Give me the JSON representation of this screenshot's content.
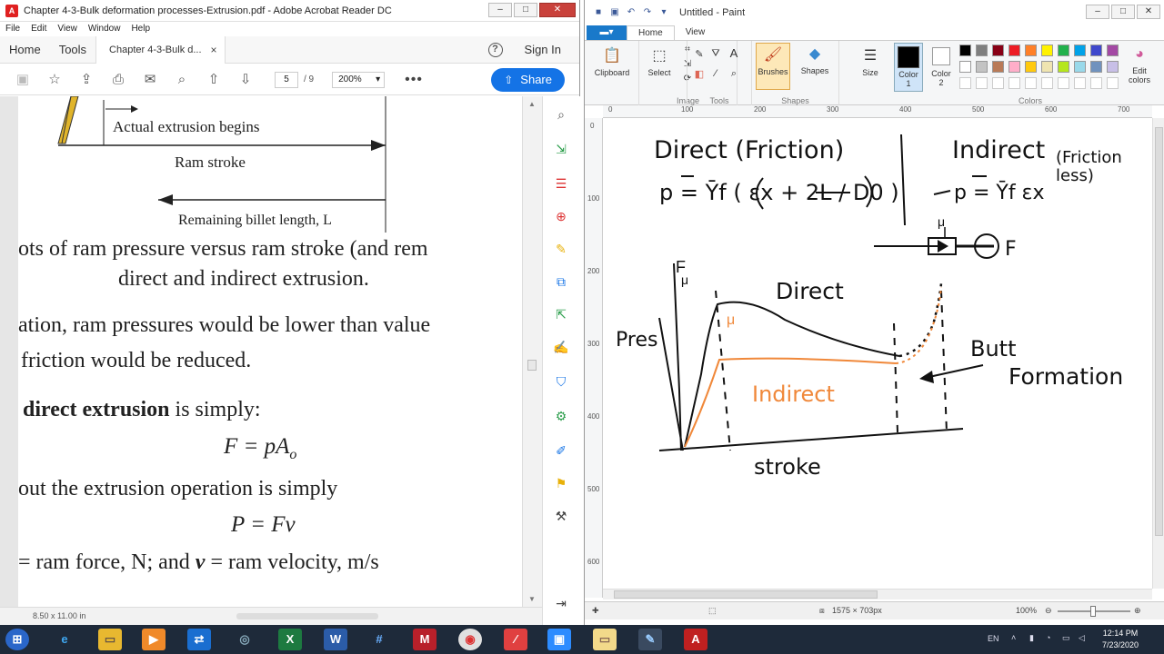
{
  "acrobat": {
    "title": "Chapter 4-3-Bulk deformation processes-Extrusion.pdf - Adobe Acrobat Reader DC",
    "menu": [
      "File",
      "Edit",
      "View",
      "Window",
      "Help"
    ],
    "tabs": {
      "home": "Home",
      "tools": "Tools",
      "doc": "Chapter 4-3-Bulk d...",
      "close": "×"
    },
    "signin": "Sign In",
    "help": "?",
    "toolbar": {
      "page_current": "5",
      "page_total": "/ 9",
      "zoom": "200%",
      "share": "Share"
    },
    "document": {
      "fig_label_begins": "Actual extrusion begins",
      "fig_label_stroke": "Ram stroke",
      "fig_label_remaining": "Remaining billet length, L",
      "line1": "ots of ram pressure versus ram stroke (and rem",
      "line2": "direct and indirect extrusion.",
      "line3": "ation, ram pressures would be lower than value",
      "line4": "friction would be reduced.",
      "line5_bold": "direct extrusion",
      "line5_rest": " is simply:",
      "eq1": "F = pA",
      "eq1_sub": "o",
      "line6": "out the extrusion operation is simply",
      "eq2": "P = Fv",
      "line7_a": "= ram force, N; and ",
      "line7_v": "v",
      "line7_b": " = ram velocity, m/s"
    },
    "status": {
      "size": "8.50 x 11.00 in"
    }
  },
  "paint": {
    "title": "Untitled - Paint",
    "tabs": {
      "file": "",
      "home": "Home",
      "view": "View"
    },
    "ribbon": {
      "clipboard": "Clipboard",
      "select": "Select",
      "image": "Image",
      "tools": "Tools",
      "brushes": "Brushes",
      "shapes_btn": "Shapes",
      "shapes": "Shapes",
      "size": "Size",
      "color1": "Color 1",
      "color2": "Color 2",
      "edit_colors": "Edit colors",
      "colors": "Colors"
    },
    "palette": {
      "color1": "#000000",
      "color2": "#ffffff",
      "row1": [
        "#000000",
        "#7f7f7f",
        "#880015",
        "#ed1c24",
        "#ff7f27",
        "#fff200",
        "#22b14c",
        "#00a2e8",
        "#3f48cc",
        "#a349a4"
      ],
      "row2": [
        "#ffffff",
        "#c3c3c3",
        "#b97a57",
        "#ffaec9",
        "#ffc90e",
        "#efe4b0",
        "#b5e61d",
        "#99d9ea",
        "#7092be",
        "#c8bfe7"
      ]
    },
    "ruler_h": [
      "0",
      "100",
      "200",
      "300",
      "400",
      "500",
      "600",
      "700"
    ],
    "ruler_v": [
      "0",
      "100",
      "200",
      "300",
      "400",
      "500",
      "600"
    ],
    "canvas": {
      "direct_friction": "Direct  (Friction)",
      "eq_direct": "p = Ȳf  ( εx + 2L / D0 )",
      "indirect_title": "Indirect",
      "friction_less": "(Friction less)",
      "eq_indirect": "p = Ȳf εx",
      "mu_top": "μ",
      "F_right": "F",
      "F_axis": "F",
      "mu_axis": "μ",
      "pressure": "Pres",
      "direct_label": "Direct",
      "mu_orange": "μ",
      "butt": "Butt",
      "formation": "Formation",
      "indirect_label": "Indirect",
      "stroke": "stroke"
    },
    "status": {
      "dimensions": "1575 × 703px",
      "zoom": "100%"
    },
    "colors": {
      "ink": "#111111",
      "orange": "#f0883a"
    }
  },
  "taskbar": {
    "lang": "EN",
    "time": "12:14 PM",
    "date": "7/23/2020"
  }
}
